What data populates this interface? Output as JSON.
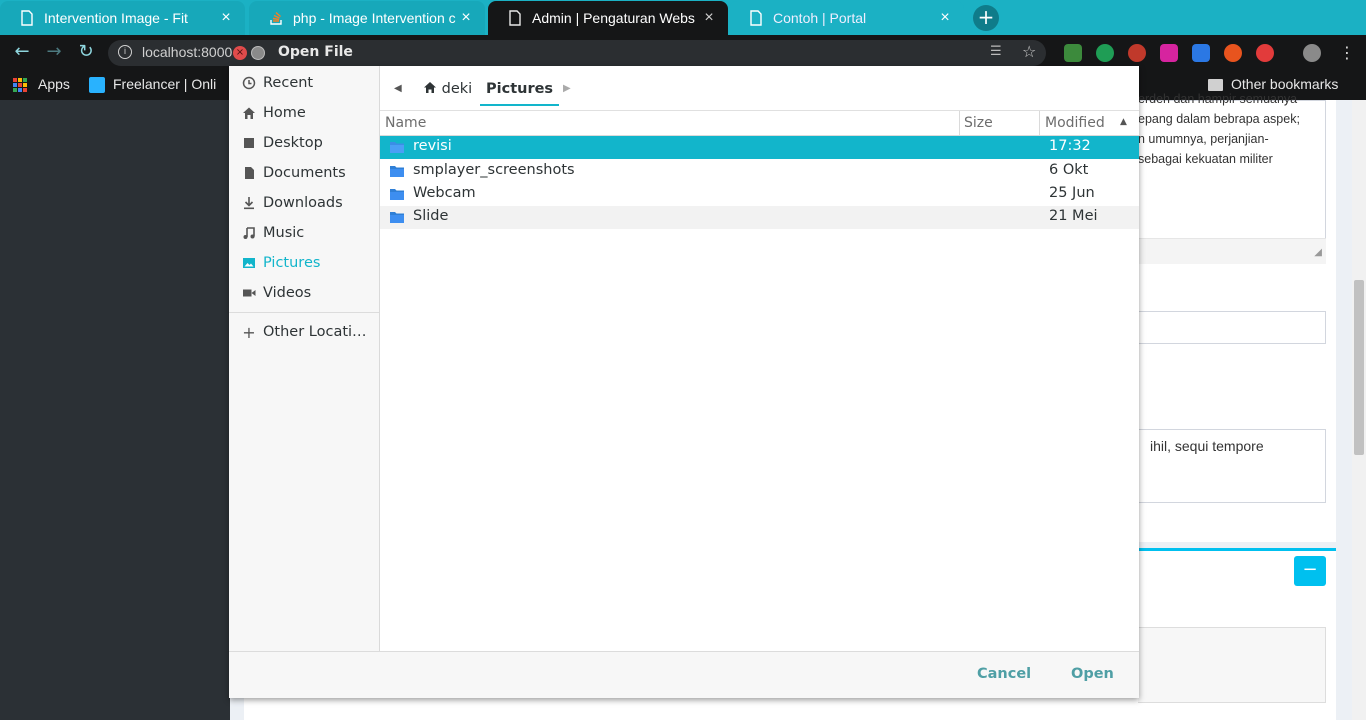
{
  "browser": {
    "tabs": [
      {
        "title": "Intervention Image - Fit",
        "active": false
      },
      {
        "title": "php - Image Intervention c",
        "active": false
      },
      {
        "title": "Admin | Pengaturan Webs",
        "active": true
      },
      {
        "title": "Contoh | Portal",
        "active": false
      }
    ],
    "new_tab_label": "+",
    "close_glyph": "×",
    "url": "localhost:8000",
    "bookmarks": {
      "apps_label": "Apps",
      "freelancer_label": "Freelancer | Onli",
      "other_label": "Other bookmarks"
    },
    "colors": {
      "tabbar": "#1bb1c4",
      "toolbar": "#151617",
      "accent": "#12b5cb"
    }
  },
  "page": {
    "textarea_lines": [
      "erdeh dan hampir semuanya",
      "epang dalam bebrapa aspek;",
      "n umumnya, perjanjian-",
      "sebagai kekuatan militer"
    ],
    "small_textarea_text": "ihil, sequi tempore",
    "collapse_label": "−"
  },
  "dialog": {
    "title": "Open File",
    "sidebar": {
      "items": [
        {
          "label": "Recent",
          "icon": "recent-icon"
        },
        {
          "label": "Home",
          "icon": "home-icon"
        },
        {
          "label": "Desktop",
          "icon": "desktop-icon"
        },
        {
          "label": "Documents",
          "icon": "documents-icon"
        },
        {
          "label": "Downloads",
          "icon": "downloads-icon"
        },
        {
          "label": "Music",
          "icon": "music-icon"
        },
        {
          "label": "Pictures",
          "icon": "pictures-icon",
          "active": true
        },
        {
          "label": "Videos",
          "icon": "videos-icon"
        }
      ],
      "other_locations": "Other Locati…"
    },
    "path": {
      "home": "deki",
      "current": "Pictures"
    },
    "columns": {
      "name": "Name",
      "size": "Size",
      "modified": "Modified"
    },
    "files": [
      {
        "name": "revisi",
        "size": "",
        "modified": "17:32",
        "selected": true
      },
      {
        "name": "smplayer_screenshots",
        "size": "",
        "modified": "6 Okt"
      },
      {
        "name": "Webcam",
        "size": "",
        "modified": "25 Jun"
      },
      {
        "name": "Slide",
        "size": "",
        "modified": "21 Mei"
      }
    ],
    "buttons": {
      "cancel": "Cancel",
      "open": "Open"
    }
  }
}
